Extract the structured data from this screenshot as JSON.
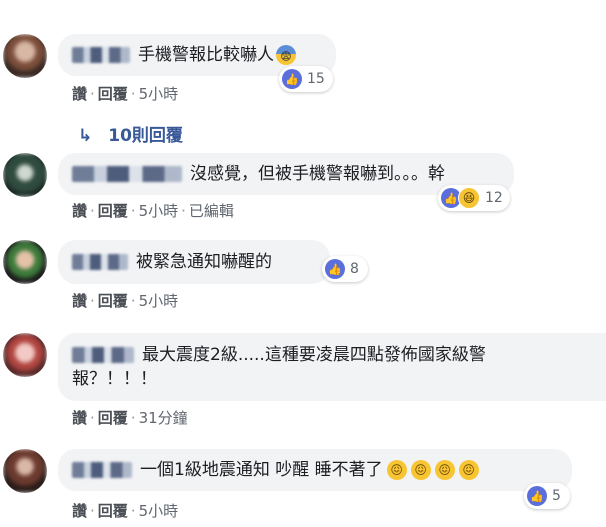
{
  "comments": [
    {
      "text": "手機警報比較嚇人",
      "reaction_count": "15",
      "actions": {
        "like": "讚",
        "reply": "回覆",
        "time": "5小時"
      }
    },
    {
      "text": "沒感覺，但被手機警報嚇到。。。幹",
      "reaction_count": "12",
      "actions": {
        "like": "讚",
        "reply": "回覆",
        "time": "5小時",
        "edited": "已編輯"
      }
    },
    {
      "text": "被緊急通知嚇醒的",
      "reaction_count": "8",
      "actions": {
        "like": "讚",
        "reply": "回覆",
        "time": "5小時"
      }
    },
    {
      "text_line1": "最大震度2級.....這種要凌晨四點發佈國家級警",
      "text_line2": "報？！！！",
      "actions": {
        "like": "讚",
        "reply": "回覆",
        "time": "31分鐘"
      }
    },
    {
      "text": "一個1級地震通知 吵醒 睡不著了",
      "reaction_count": "5",
      "actions": {
        "like": "讚",
        "reply": "回覆",
        "time": "5小時"
      }
    }
  ],
  "replies": {
    "label": "10則回覆",
    "arrow": "↳"
  },
  "icons": {
    "like": "thumbs-up-icon",
    "haha": "haha-icon",
    "fear": "fearful-emoji-icon",
    "tired": "tired-emoji-icon"
  },
  "colors": {
    "bubble": "#f2f3f5",
    "like_blue": "#5b6fdc",
    "link_blue": "#385898"
  }
}
